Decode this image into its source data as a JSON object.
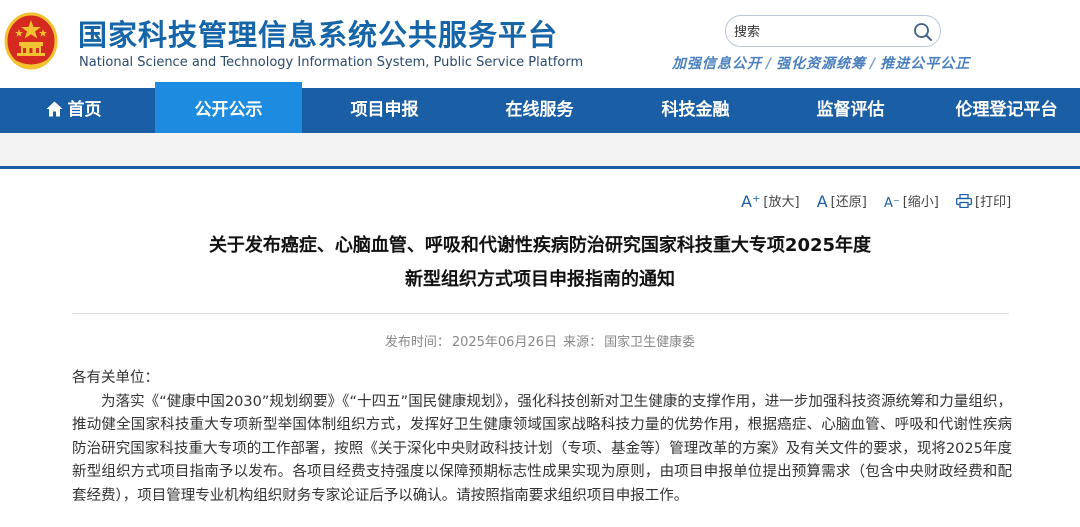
{
  "header": {
    "title_cn": "国家科技管理信息系统公共服务平台",
    "title_en": "National Science and Technology Information System, Public Service Platform",
    "search": {
      "placeholder": "搜索"
    },
    "slogan": [
      "加强信息公开",
      "强化资源统筹",
      "推进公平公正"
    ],
    "slogan_separator": "/"
  },
  "nav": {
    "items": [
      {
        "label": "首页"
      },
      {
        "label": "公开公示"
      },
      {
        "label": "项目申报"
      },
      {
        "label": "在线服务"
      },
      {
        "label": "科技金融"
      },
      {
        "label": "监督评估"
      },
      {
        "label": "伦理登记平台"
      }
    ],
    "active_index": 1
  },
  "tools": {
    "enlarge": "[放大]",
    "restore": "[还原]",
    "shrink": "[缩小]",
    "print": "[打印]"
  },
  "article": {
    "title_line1": "关于发布癌症、心脑血管、呼吸和代谢性疾病防治研究国家科技重大专项2025年度",
    "title_line2": "新型组织方式项目申报指南的通知",
    "meta": {
      "publish_label": "发布时间：",
      "publish_date": "2025年06月26日",
      "source_label": "来源：",
      "source": "国家卫生健康委"
    },
    "salutation": "各有关单位：",
    "paragraph": "为落实《“健康中国2030”规划纲要》《“十四五”国民健康规划》，强化科技创新对卫生健康的支撑作用，进一步加强科技资源统筹和力量组织，推动健全国家科技重大专项新型举国体制组织方式，发挥好卫生健康领域国家战略科技力量的优势作用，根据癌症、心脑血管、呼吸和代谢性疾病防治研究国家科技重大专项的工作部署，按照《关于深化中央财政科技计划（专项、基金等）管理改革的方案》及有关文件的要求，现将2025年度新型组织方式项目指南予以发布。各项目经费支持强度以保障预期标志性成果实现为原则，由项目申报单位提出预算需求（包含中央财政经费和配套经费），项目管理专业机构组织财务专家论证后予以确认。请按照指南要求组织项目申报工作。"
  },
  "colors": {
    "nav_bg": "#1a5fa6",
    "nav_active": "#1d8be0",
    "title_blue": "#1565a8",
    "emblem_red": "#d42a1f",
    "emblem_gold": "#f2c230"
  }
}
